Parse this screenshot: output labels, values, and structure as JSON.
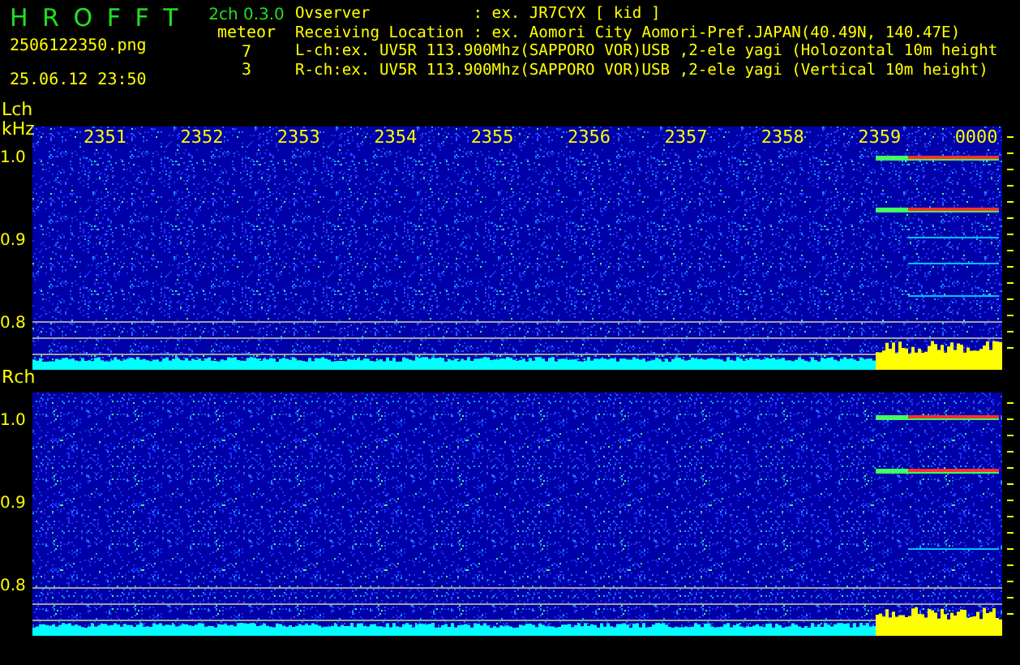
{
  "app": {
    "title": "H R O F F T",
    "version": "2ch 0.3.0",
    "filename": "2506122350.png",
    "timestamp": "25.06.12 23:50",
    "count_label": "meteor",
    "counts": [
      "7",
      "3"
    ]
  },
  "info_lines": [
    "Ovserver           : ex. JR7CYX [ kid ]",
    "Receiving Location : ex. Aomori City Aomori-Pref.JAPAN(40.49N, 140.47E)",
    "L-ch:ex. UV5R 113.900Mhz(SAPPORO VOR)USB ,2-ele yagi (Holozontal 10m height",
    "R-ch:ex. UV5R 113.900Mhz(SAPPORO VOR)USB ,2-ele yagi (Vertical 10m height)"
  ],
  "panels": [
    {
      "channel": "Lch",
      "unit": "kHz",
      "time_labels": [
        "2351",
        "2352",
        "2353",
        "2354",
        "2355",
        "2356",
        "2357",
        "2358",
        "2359",
        "0000"
      ],
      "freq_labels": [
        "1.0",
        "0.9",
        "0.8"
      ]
    },
    {
      "channel": "Rch",
      "freq_labels": [
        "1.0",
        "0.9",
        "0.8"
      ]
    }
  ]
}
